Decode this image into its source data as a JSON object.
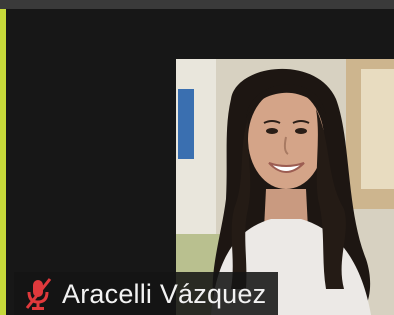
{
  "participant": {
    "name": "Aracelli Vázquez",
    "audio_status": "muted",
    "mic_icon": "muted-microphone-icon",
    "video_on": true,
    "is_speaking": true
  },
  "colors": {
    "speaking_border": "#c6d93a",
    "muted_icon": "#e0393c",
    "tile_background": "#171717"
  }
}
